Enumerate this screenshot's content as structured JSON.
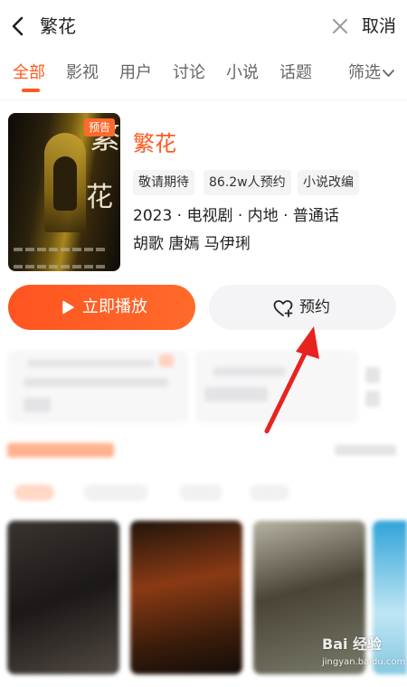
{
  "search": {
    "query": "繁花",
    "cancel_label": "取消"
  },
  "tabs": {
    "items": [
      {
        "label": "全部",
        "active": true
      },
      {
        "label": "影视",
        "active": false
      },
      {
        "label": "用户",
        "active": false
      },
      {
        "label": "讨论",
        "active": false
      },
      {
        "label": "小说",
        "active": false
      },
      {
        "label": "话题",
        "active": false
      }
    ],
    "filter_label": "筛选"
  },
  "show": {
    "title": "繁花",
    "poster_badge": "预告",
    "poster_title": [
      "繁",
      "花"
    ],
    "tags": [
      "敬请期待",
      "86.2w人预约",
      "小说改编"
    ],
    "info_line": "2023 · 电视剧 · 内地 · 普通话",
    "cast_line": "胡歌 唐嫣 马伊琍"
  },
  "actions": {
    "play_label": "立即播放",
    "reserve_label": "预约"
  },
  "icons": {
    "back": "back-arrow-icon",
    "clear": "close-icon",
    "filter": "chevron-down-icon",
    "play": "play-icon",
    "reserve": "heart-plus-icon"
  },
  "watermark": {
    "logo": "Bai 经验",
    "url": "jingyan.baidu.com"
  },
  "colors": {
    "accent": "#ff5a1f",
    "arrow": "#e8231f",
    "button_gray": "#f4f4f6"
  }
}
